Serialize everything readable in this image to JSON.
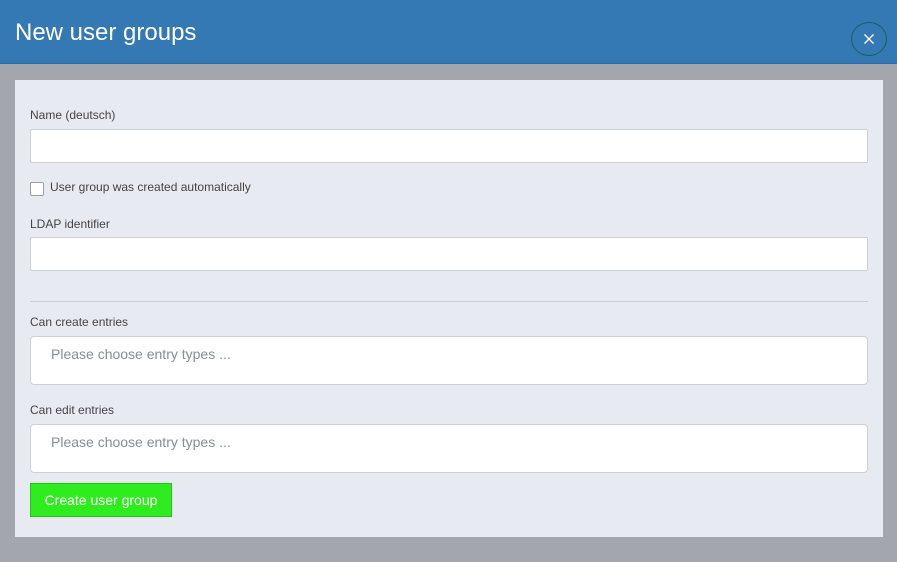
{
  "dialog": {
    "title": "New user groups",
    "close_icon": "close-icon"
  },
  "form": {
    "name_label": "Name (deutsch)",
    "name_value": "",
    "auto_created_label": "User group was created automatically",
    "auto_created_checked": false,
    "ldap_label": "LDAP identifier",
    "ldap_value": "",
    "can_create_label": "Can create entries",
    "can_create_placeholder": "Please choose entry types ...",
    "can_edit_label": "Can edit entries",
    "can_edit_placeholder": "Please choose entry types ...",
    "submit_label": "Create user group"
  },
  "colors": {
    "header": "#3478b4",
    "backdrop": "#a3a6ad",
    "panel": "#e8eaf2",
    "submit": "#2fec1f"
  }
}
